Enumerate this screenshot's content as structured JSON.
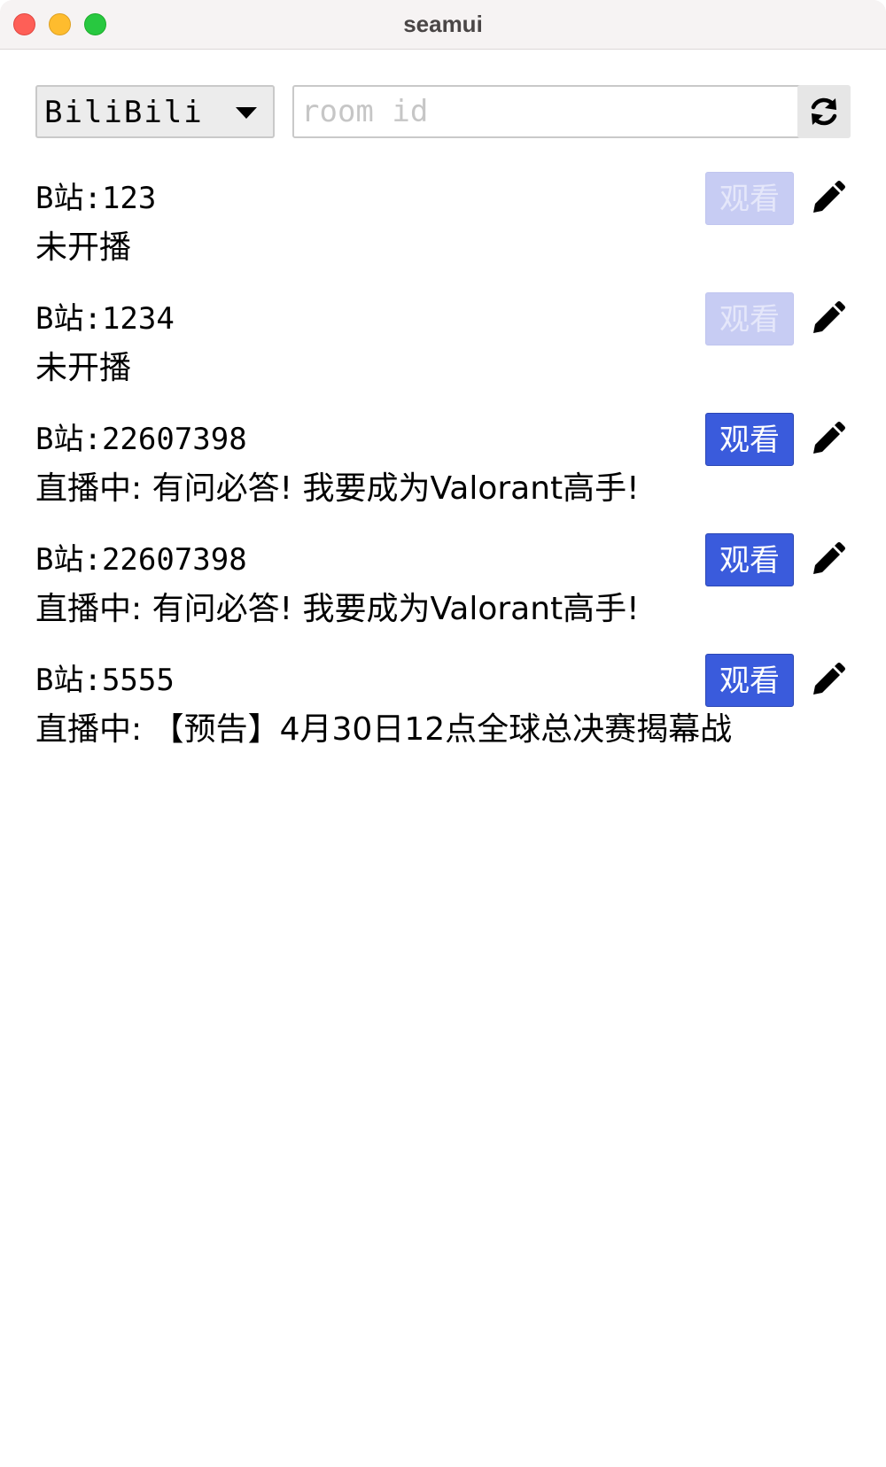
{
  "window": {
    "title": "seamui"
  },
  "toolbar": {
    "platform_selected": "BiliBili",
    "room_input_placeholder": "room id",
    "room_input_value": "",
    "refresh_icon": "refresh-icon"
  },
  "rooms": [
    {
      "name": "B站:123",
      "status": "未开播",
      "watch_label": "观看",
      "watch_enabled": false
    },
    {
      "name": "B站:1234",
      "status": "未开播",
      "watch_label": "观看",
      "watch_enabled": false
    },
    {
      "name": "B站:22607398",
      "status": "直播中: 有问必答! 我要成为Valorant高手!",
      "watch_label": "观看",
      "watch_enabled": true
    },
    {
      "name": "B站:22607398",
      "status": "直播中: 有问必答! 我要成为Valorant高手!",
      "watch_label": "观看",
      "watch_enabled": true
    },
    {
      "name": "B站:5555",
      "status": "直播中: 【预告】4月30日12点全球总决赛揭幕战",
      "watch_label": "观看",
      "watch_enabled": true
    }
  ],
  "colors": {
    "watch_enabled_bg": "#3a5bdc",
    "watch_disabled_bg": "#c7ccf3"
  }
}
